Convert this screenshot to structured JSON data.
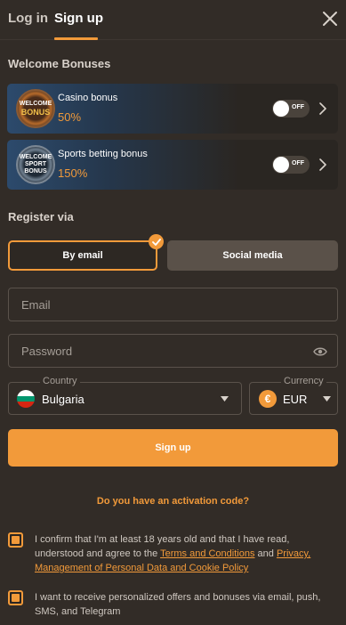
{
  "tabs": {
    "login": "Log in",
    "signup": "Sign up"
  },
  "welcome": {
    "title": "Welcome Bonuses",
    "bonuses": [
      {
        "badge_top": "WELCOME",
        "badge_main": "BONUS",
        "name": "Casino bonus",
        "value": "50%",
        "toggle": "OFF"
      },
      {
        "badge_top": "WELCOME",
        "badge_main": "SPORT BONUS",
        "name": "Sports betting bonus",
        "value": "150%",
        "toggle": "OFF"
      }
    ]
  },
  "register": {
    "title": "Register via",
    "by_email": "By email",
    "social": "Social media"
  },
  "form": {
    "email_placeholder": "Email",
    "password_placeholder": "Password",
    "country_label": "Country",
    "country_value": "Bulgaria",
    "currency_label": "Currency",
    "currency_value": "EUR",
    "currency_symbol": "€",
    "submit": "Sign up"
  },
  "activation": "Do you have an activation code?",
  "consent": {
    "age_prefix": "I confirm that I'm at least 18 years old and that I have read, understood and agree to the ",
    "terms_link": "Terms and Conditions",
    "and": " and ",
    "privacy_link": "Privacy, Management of Personal Data and Cookie Policy",
    "offers": "I want to receive personalized offers and bonuses via email, push, SMS, and Telegram"
  },
  "colors": {
    "accent": "#f29a3a",
    "background": "#322c27",
    "secondary_button": "#5a5149"
  },
  "flag_colors": [
    "#ffffff",
    "#00966e",
    "#d62612"
  ]
}
